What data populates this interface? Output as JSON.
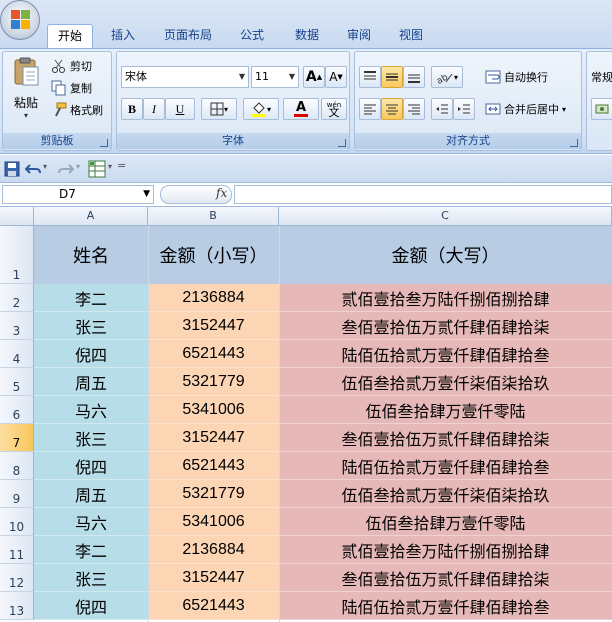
{
  "tabs": [
    "开始",
    "插入",
    "页面布局",
    "公式",
    "数据",
    "审阅",
    "视图"
  ],
  "clipboard": {
    "paste_label": "粘贴",
    "cut_label": "剪切",
    "copy_label": "复制",
    "format_painter_label": "格式刷",
    "group_label": "剪贴板"
  },
  "font": {
    "name": "宋体",
    "size": "11",
    "grow_label": "A",
    "shrink_label": "A",
    "bold_label": "B",
    "italic_label": "I",
    "underline_label": "U",
    "font_color_label": "A",
    "wen_label": "wén",
    "wen_char": "文",
    "group_label": "字体"
  },
  "alignment": {
    "wrap_label": "自动换行",
    "merge_label": "合并后居中",
    "group_label": "对齐方式"
  },
  "number": {
    "format_value": "常规"
  },
  "formula_bar": {
    "name_box": "D7",
    "fx_label": "fx",
    "content": ""
  },
  "columns": [
    "A",
    "B",
    "C"
  ],
  "header_row": {
    "row_number": "1",
    "col_a": "姓名",
    "col_b": "金额（小写）",
    "col_c": "金额（大写）"
  },
  "rows": [
    {
      "n": "2",
      "name": "李二",
      "amount": "2136884",
      "upper": "贰佰壹拾叁万陆仟捌佰捌拾肆"
    },
    {
      "n": "3",
      "name": "张三",
      "amount": "3152447",
      "upper": "叁佰壹拾伍万贰仟肆佰肆拾柒"
    },
    {
      "n": "4",
      "name": "倪四",
      "amount": "6521443",
      "upper": "陆佰伍拾贰万壹仟肆佰肆拾叁"
    },
    {
      "n": "5",
      "name": "周五",
      "amount": "5321779",
      "upper": "伍佰叁拾贰万壹仟柒佰柒拾玖"
    },
    {
      "n": "6",
      "name": "马六",
      "amount": "5341006",
      "upper": "伍佰叁拾肆万壹仟零陆"
    },
    {
      "n": "7",
      "name": "张三",
      "amount": "3152447",
      "upper": "叁佰壹拾伍万贰仟肆佰肆拾柒"
    },
    {
      "n": "8",
      "name": "倪四",
      "amount": "6521443",
      "upper": "陆佰伍拾贰万壹仟肆佰肆拾叁"
    },
    {
      "n": "9",
      "name": "周五",
      "amount": "5321779",
      "upper": "伍佰叁拾贰万壹仟柒佰柒拾玖"
    },
    {
      "n": "10",
      "name": "马六",
      "amount": "5341006",
      "upper": "伍佰叁拾肆万壹仟零陆"
    },
    {
      "n": "11",
      "name": "李二",
      "amount": "2136884",
      "upper": "贰佰壹拾叁万陆仟捌佰捌拾肆"
    },
    {
      "n": "12",
      "name": "张三",
      "amount": "3152447",
      "upper": "叁佰壹拾伍万贰仟肆佰肆拾柒"
    },
    {
      "n": "13",
      "name": "倪四",
      "amount": "6521443",
      "upper": "陆佰伍拾贰万壹仟肆佰肆拾叁"
    }
  ],
  "selected_row": "7",
  "colors": {
    "col_a_fill": "#b7dde8",
    "col_b_fill": "#fcd5b4",
    "col_c_fill": "#e6b9b8",
    "header_fill": "#b8cce4"
  }
}
